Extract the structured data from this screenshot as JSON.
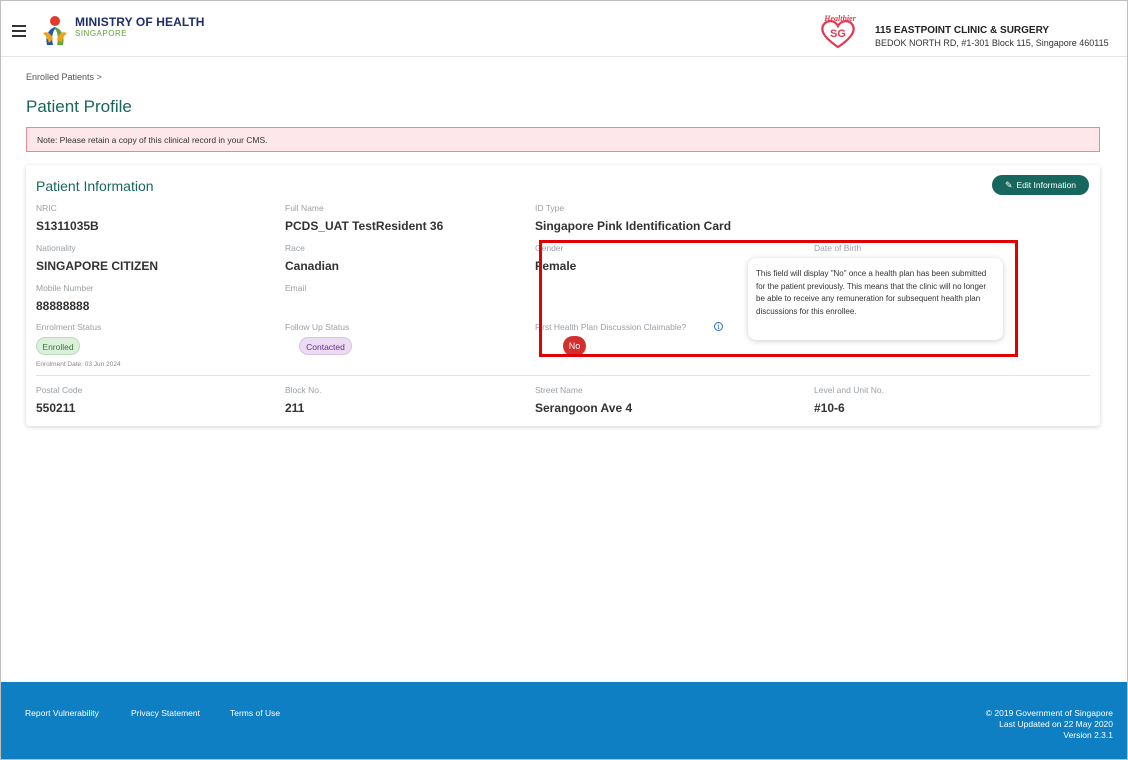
{
  "header": {
    "ministry_name": "MINISTRY OF HEALTH",
    "ministry_country": "SINGAPORE",
    "partner_logo_text": "Healthier SG",
    "clinic_name": "115 EASTPOINT CLINIC & SURGERY",
    "clinic_address": "BEDOK NORTH RD, #1-301 Block 115, Singapore 460115"
  },
  "breadcrumb": "Enrolled Patients  >",
  "page_title": "Patient Profile",
  "note": "Note: Please retain a copy of this clinical record in your CMS.",
  "patient_info": {
    "title": "Patient Information",
    "edit_button": "Edit Information",
    "nric": {
      "label": "NRIC",
      "value": "S1311035B"
    },
    "full_name": {
      "label": "Full Name",
      "value": "PCDS_UAT TestResident 36"
    },
    "id_type": {
      "label": "ID Type",
      "value": "Singapore Pink Identification Card"
    },
    "nationality": {
      "label": "Nationality",
      "value": "SINGAPORE CITIZEN"
    },
    "race": {
      "label": "Race",
      "value": "Canadian"
    },
    "gender": {
      "label": "Gender",
      "value": "Female"
    },
    "dob": {
      "label": "Date of Birth",
      "value": ""
    },
    "mobile": {
      "label": "Mobile Number",
      "value": "88888888"
    },
    "email": {
      "label": "Email",
      "value": ""
    },
    "enrolment_status": {
      "label": "Enrolment Status",
      "value": "Enrolled",
      "date": "Enrolment Date: 03 Jun 2024"
    },
    "follow_up_status": {
      "label": "Follow Up Status",
      "value": "Contacted"
    },
    "first_plan_claimable": {
      "label": "First Health Plan Discussion Claimable?",
      "value": "No"
    },
    "postal_code": {
      "label": "Postal Code",
      "value": "550211"
    },
    "block_no": {
      "label": "Block No.",
      "value": "211"
    },
    "street_name": {
      "label": "Street Name",
      "value": "Serangoon Ave 4"
    },
    "level_unit": {
      "label": "Level and Unit No.",
      "value": "#10-6"
    }
  },
  "tooltip": "This field will display \"No\" once a health plan has been submitted for the patient previously. This means that the clinic will no longer be able to receive any remuneration for subsequent health plan discussions for this enrollee.",
  "footer": {
    "links": [
      "Report Vulnerability",
      "Privacy Statement",
      "Terms of Use"
    ],
    "copyright": "© 2019 Government of Singapore",
    "last_updated": "Last Updated on 22 May 2020",
    "version": "Version 2.3.1"
  },
  "colors": {
    "primary_teal": "#17675e",
    "footer_blue": "#0e7fc2",
    "highlight_red": "#e00000",
    "badge_no_red": "#d32f2f"
  }
}
